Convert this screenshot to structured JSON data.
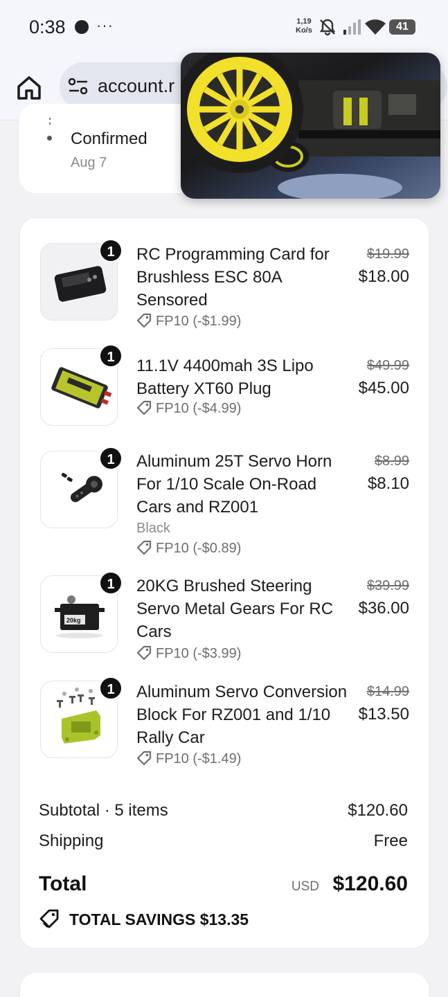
{
  "status_bar": {
    "time": "0:38",
    "more": "···",
    "net_speed_value": "1,19",
    "net_speed_unit": "Ko/s",
    "battery": "41"
  },
  "browser": {
    "url": "account.r"
  },
  "order_status": {
    "label": "Confirmed",
    "date": "Aug 7"
  },
  "items": [
    {
      "qty": "1",
      "title": "RC Programming Card for Brushless ESC 80A Sensored",
      "variant": "",
      "coupon": "FP10 (-$1.99)",
      "original_price": "$19.99",
      "price": "$18.00",
      "image": "programming-card"
    },
    {
      "qty": "1",
      "title": "11.1V 4400mah 3S Lipo Battery XT60 Plug",
      "variant": "",
      "coupon": "FP10 (-$4.99)",
      "original_price": "$49.99",
      "price": "$45.00",
      "image": "lipo-battery"
    },
    {
      "qty": "1",
      "title": "Aluminum 25T Servo Horn For 1/10 Scale On-Road Cars and RZ001",
      "variant": "Black",
      "coupon": "FP10 (-$0.89)",
      "original_price": "$8.99",
      "price": "$8.10",
      "image": "servo-horn"
    },
    {
      "qty": "1",
      "title": "20KG Brushed Steering Servo Metal Gears For RC Cars",
      "variant": "",
      "coupon": "FP10 (-$3.99)",
      "original_price": "$39.99",
      "price": "$36.00",
      "image": "steering-servo"
    },
    {
      "qty": "1",
      "title": "Aluminum Servo Conversion Block For RZ001 and 1/10 Rally Car",
      "variant": "",
      "coupon": "FP10 (-$1.49)",
      "original_price": "$14.99",
      "price": "$13.50",
      "image": "servo-block"
    }
  ],
  "summary": {
    "subtotal_label": "Subtotal · 5 items",
    "subtotal_value": "$120.60",
    "shipping_label": "Shipping",
    "shipping_value": "Free",
    "total_label": "Total",
    "currency": "USD",
    "total_value": "$120.60",
    "savings": "TOTAL SAVINGS $13.35"
  },
  "colors": {
    "background": "#f2f2f5",
    "card": "#ffffff",
    "qty_badge": "#111111",
    "wheel_yellow": "#f2e02a"
  },
  "icons": [
    "home-icon",
    "site-settings-icon",
    "tag-icon",
    "bell-off-icon",
    "signal-icon",
    "wifi-icon"
  ]
}
